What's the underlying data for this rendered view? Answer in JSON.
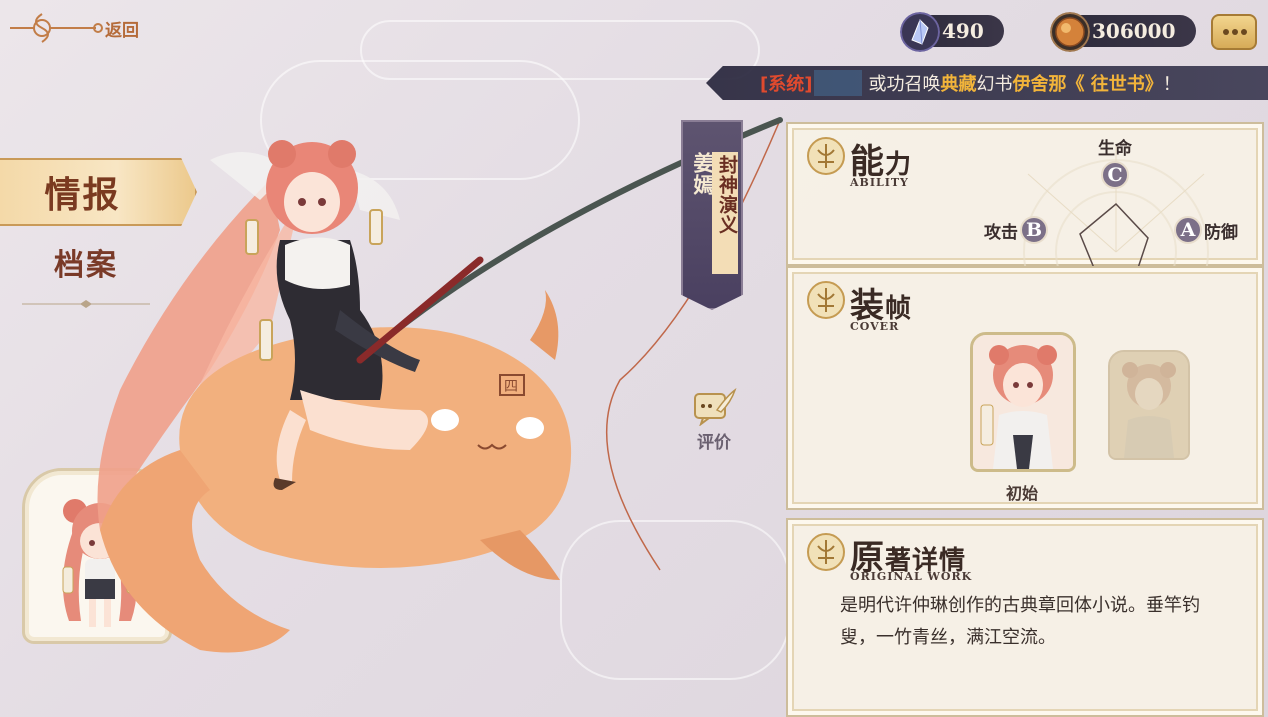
{
  "nav": {
    "back_label": "返回",
    "info_label": "情报",
    "archive_label": "档案"
  },
  "character": {
    "name": "姜嫣",
    "series": "封神演义"
  },
  "review": {
    "label": "评价"
  },
  "currency": {
    "crystal": "490",
    "coin": "306000"
  },
  "marquee": {
    "tag": "[系统]",
    "text_1": "或功召唤",
    "hl_1": "典藏",
    "text_2": "幻书",
    "hl_2": "伊舍那《 往世书》",
    "text_3": "！"
  },
  "ability": {
    "title_big": "能",
    "title_small": "力",
    "subtitle": "ABILITY",
    "hp_label": "生命",
    "hp_grade": "C",
    "atk_label": "攻击",
    "atk_grade": "B",
    "def_label": "防御",
    "def_grade": "A"
  },
  "cover": {
    "title_big": "装",
    "title_small": "帧",
    "subtitle": "COVER",
    "item_1_label": "初始"
  },
  "origin": {
    "title_big": "原",
    "title_small": "著详情",
    "subtitle": "ORIGINAL  WORK",
    "description": "是明代许仲琳创作的古典章回体小说。垂竿钓叟，一竹青丝，满江空流。"
  },
  "colors": {
    "accent_gold": "#c99a58",
    "marquee_tag": "#e04a2e",
    "marquee_highlight": "#f2b43a",
    "banner": "#4a4060"
  }
}
